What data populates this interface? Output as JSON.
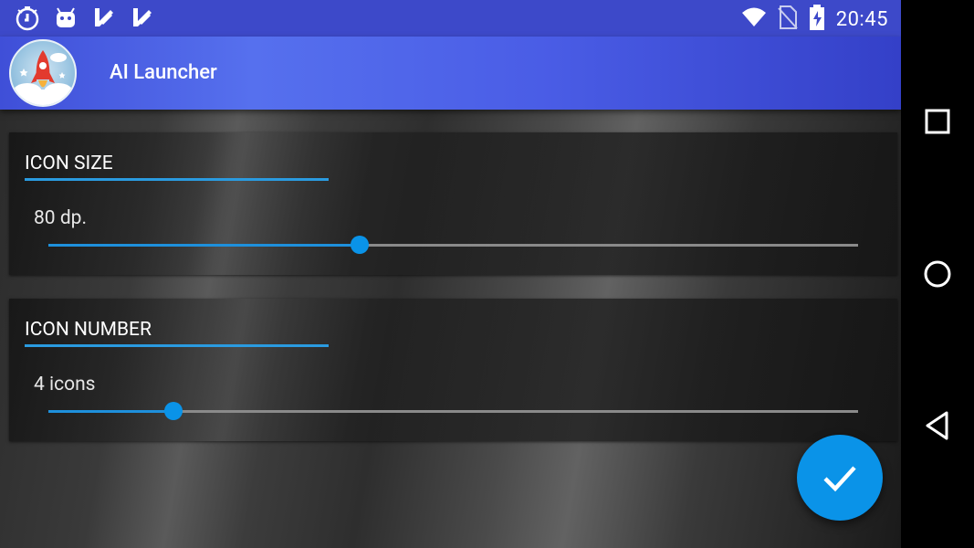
{
  "status_bar": {
    "time": "20:45",
    "left_icons": [
      "timer-app-icon",
      "android-icon",
      "checkmark-app-icon",
      "checkmark-app-icon"
    ],
    "right_icons": [
      "wifi-icon",
      "no-sim-icon",
      "battery-charging-icon"
    ]
  },
  "app_bar": {
    "title": "AI Launcher",
    "logo_icon": "rocket-icon"
  },
  "settings": {
    "icon_size": {
      "title": "ICON SIZE",
      "value_label": "80 dp.",
      "slider_fraction": 0.385
    },
    "icon_number": {
      "title": "ICON NUMBER",
      "value_label": "4 icons",
      "slider_fraction": 0.154
    }
  },
  "fab": {
    "icon": "check-icon"
  },
  "navigation_bar": {
    "buttons": [
      "recents-icon",
      "home-icon",
      "back-icon"
    ]
  },
  "colors": {
    "status_bar": "#3d49c9",
    "app_bar": "#4a5de6",
    "accent": "#0a93e8"
  }
}
